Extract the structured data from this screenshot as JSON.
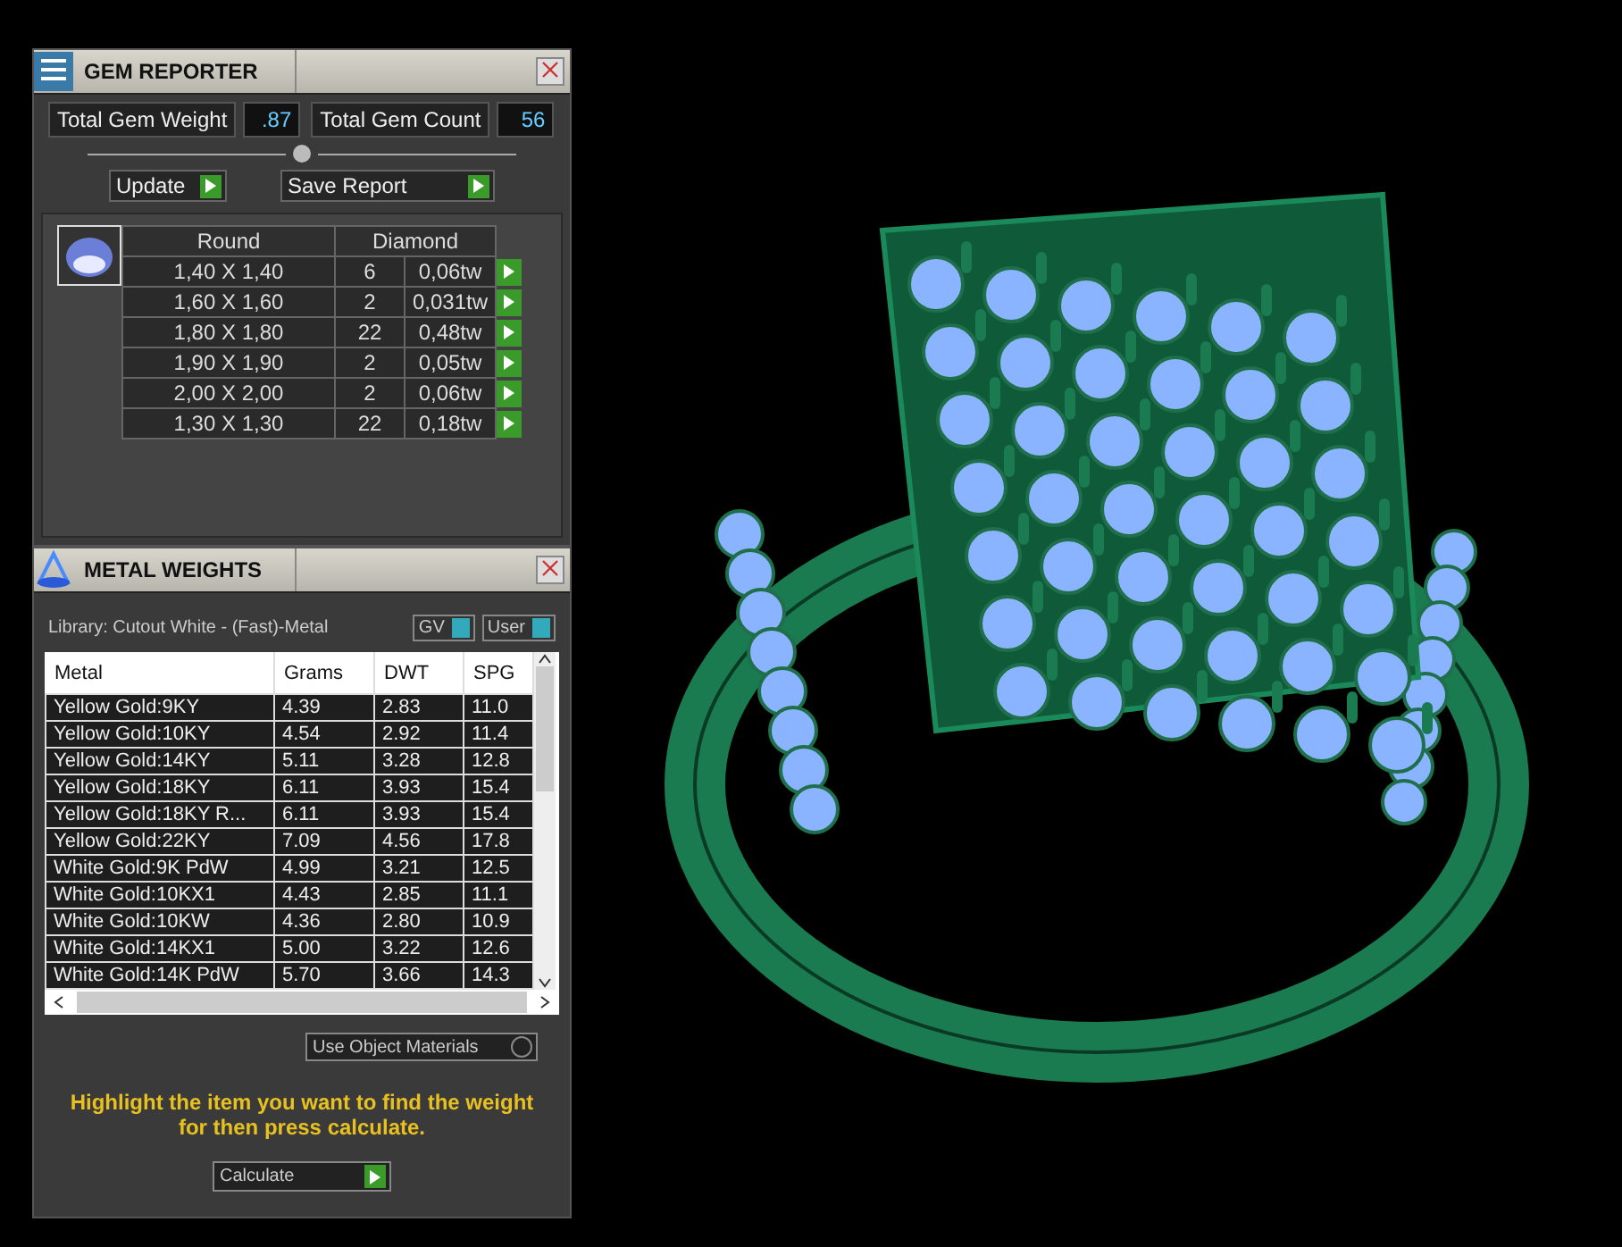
{
  "gem_reporter": {
    "title": "GEM REPORTER",
    "total_weight_label": "Total Gem Weight",
    "total_weight": ".87",
    "total_count_label": "Total Gem Count",
    "total_count": "56",
    "buttons": [
      "Update",
      "Save Report"
    ],
    "table": {
      "columns": [
        "Round",
        "Diamond"
      ],
      "rows": [
        {
          "size": "1,40 X 1,40",
          "count": "6",
          "weight": "0,06tw"
        },
        {
          "size": "1,60 X 1,60",
          "count": "2",
          "weight": "0,031tw"
        },
        {
          "size": "1,80 X 1,80",
          "count": "22",
          "weight": "0,48tw"
        },
        {
          "size": "1,90 X 1,90",
          "count": "2",
          "weight": "0,05tw"
        },
        {
          "size": "2,00 X 2,00",
          "count": "2",
          "weight": "0,06tw"
        },
        {
          "size": "1,30 X 1,30",
          "count": "22",
          "weight": "0,18tw"
        }
      ]
    }
  },
  "metal_weights": {
    "title": "METAL WEIGHTS",
    "library": "Library: Cutout White - (Fast)-Metal",
    "toggles": [
      "GV",
      "User"
    ],
    "columns": [
      "Metal",
      "Grams",
      "DWT",
      "SPG"
    ],
    "rows": [
      [
        "Yellow Gold:9KY",
        "4.39",
        "2.83",
        "11.0"
      ],
      [
        "Yellow Gold:10KY",
        "4.54",
        "2.92",
        "11.4"
      ],
      [
        "Yellow Gold:14KY",
        "5.11",
        "3.28",
        "12.8"
      ],
      [
        "Yellow Gold:18KY",
        "6.11",
        "3.93",
        "15.4"
      ],
      [
        "Yellow Gold:18KY R...",
        "6.11",
        "3.93",
        "15.4"
      ],
      [
        "Yellow Gold:22KY",
        "7.09",
        "4.56",
        "17.8"
      ],
      [
        "White Gold:9K PdW",
        "4.99",
        "3.21",
        "12.5"
      ],
      [
        "White Gold:10KX1",
        "4.43",
        "2.85",
        "11.1"
      ],
      [
        "White Gold:10KW",
        "4.36",
        "2.80",
        "10.9"
      ],
      [
        "White Gold:14KX1",
        "5.00",
        "3.22",
        "12.6"
      ],
      [
        "White Gold:14K PdW",
        "5.70",
        "3.66",
        "14.3"
      ]
    ],
    "use_object_materials": "Use Object Materials",
    "hint": "Highlight the item you want to find the weight for then press calculate.",
    "calculate": "Calculate"
  }
}
